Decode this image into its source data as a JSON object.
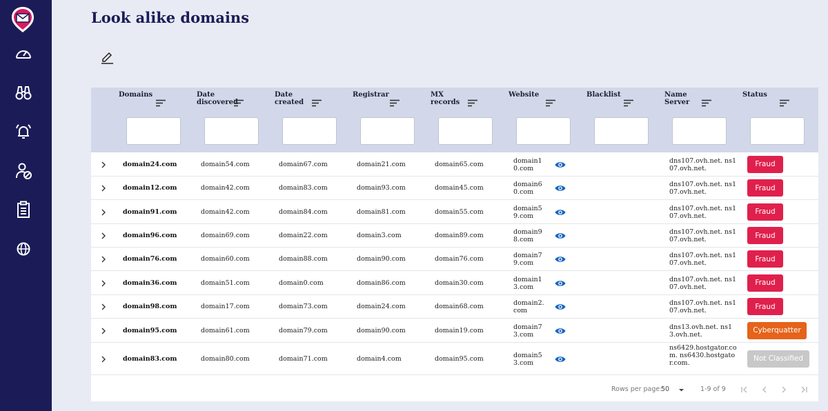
{
  "page": {
    "title": "Look alike domains"
  },
  "sidebar": {
    "items": [
      {
        "icon": "dashboard-gauge-icon"
      },
      {
        "icon": "binoculars-icon"
      },
      {
        "icon": "alarm-bell-icon"
      },
      {
        "icon": "user-block-icon"
      },
      {
        "icon": "clipboard-list-icon"
      },
      {
        "icon": "globe-icon"
      }
    ]
  },
  "table": {
    "headers": [
      "Domains",
      "Date discovered",
      "Date created",
      "Registrar",
      "MX records",
      "Website",
      "Blacklist",
      "Name Server",
      "Status"
    ],
    "rows": [
      {
        "domain": "domain24.com",
        "discovered": "domain54.com",
        "created": "domain67.com",
        "registrar": "domain21.com",
        "mx": "domain65.com",
        "website": "domain10.com",
        "ns": "dns107.ovh.net. ns107.ovh.net.",
        "status": "Fraud"
      },
      {
        "domain": "domain12.com",
        "discovered": "domain42.com",
        "created": "domain83.com",
        "registrar": "domain93.com",
        "mx": "domain45.com",
        "website": "domain60.com",
        "ns": "dns107.ovh.net. ns107.ovh.net.",
        "status": "Fraud"
      },
      {
        "domain": "domain91.com",
        "discovered": "domain42.com",
        "created": "domain84.com",
        "registrar": "domain81.com",
        "mx": "domain55.com",
        "website": "domain59.com",
        "ns": "dns107.ovh.net. ns107.ovh.net.",
        "status": "Fraud"
      },
      {
        "domain": "domain96.com",
        "discovered": "domain69.com",
        "created": "domain22.com",
        "registrar": "domain3.com",
        "mx": "domain89.com",
        "website": "domain98.com",
        "ns": "dns107.ovh.net. ns107.ovh.net.",
        "status": "Fraud"
      },
      {
        "domain": "domain76.com",
        "discovered": "domain60.com",
        "created": "domain88.com",
        "registrar": "domain90.com",
        "mx": "domain76.com",
        "website": "domain79.com",
        "ns": "dns107.ovh.net. ns107.ovh.net.",
        "status": "Fraud"
      },
      {
        "domain": "domain36.com",
        "discovered": "domain51.com",
        "created": "domain0.com",
        "registrar": "domain86.com",
        "mx": "domain30.com",
        "website": "domain13.com",
        "ns": "dns107.ovh.net. ns107.ovh.net.",
        "status": "Fraud"
      },
      {
        "domain": "domain98.com",
        "discovered": "domain17.com",
        "created": "domain73.com",
        "registrar": "domain24.com",
        "mx": "domain68.com",
        "website": "domain2.com",
        "ns": "dns107.ovh.net. ns107.ovh.net.",
        "status": "Fraud"
      },
      {
        "domain": "domain95.com",
        "discovered": "domain61.com",
        "created": "domain79.com",
        "registrar": "domain90.com",
        "mx": "domain19.com",
        "website": "domain73.com",
        "ns": "dns13.ovh.net. ns13.ovh.net.",
        "status": "Cyberquatter"
      },
      {
        "domain": "domain83.com",
        "discovered": "domain80.com",
        "created": "domain71.com",
        "registrar": "domain4.com",
        "mx": "domain95.com",
        "website": "domain53.com",
        "ns": "ns6429.hostgator.com. ns6430.hostgator.com.",
        "status": "Not Classified"
      }
    ]
  },
  "pagination": {
    "rows_per_page_label": "Rows per page:",
    "rows_per_page": "50",
    "range": "1-9 of 9"
  },
  "colors": {
    "sidebar": "#1b1c57",
    "fraud": "#e0204c",
    "cyberquatter": "#e5631a",
    "not_classified": "#c8c8c8",
    "eye": "#1565c0"
  }
}
